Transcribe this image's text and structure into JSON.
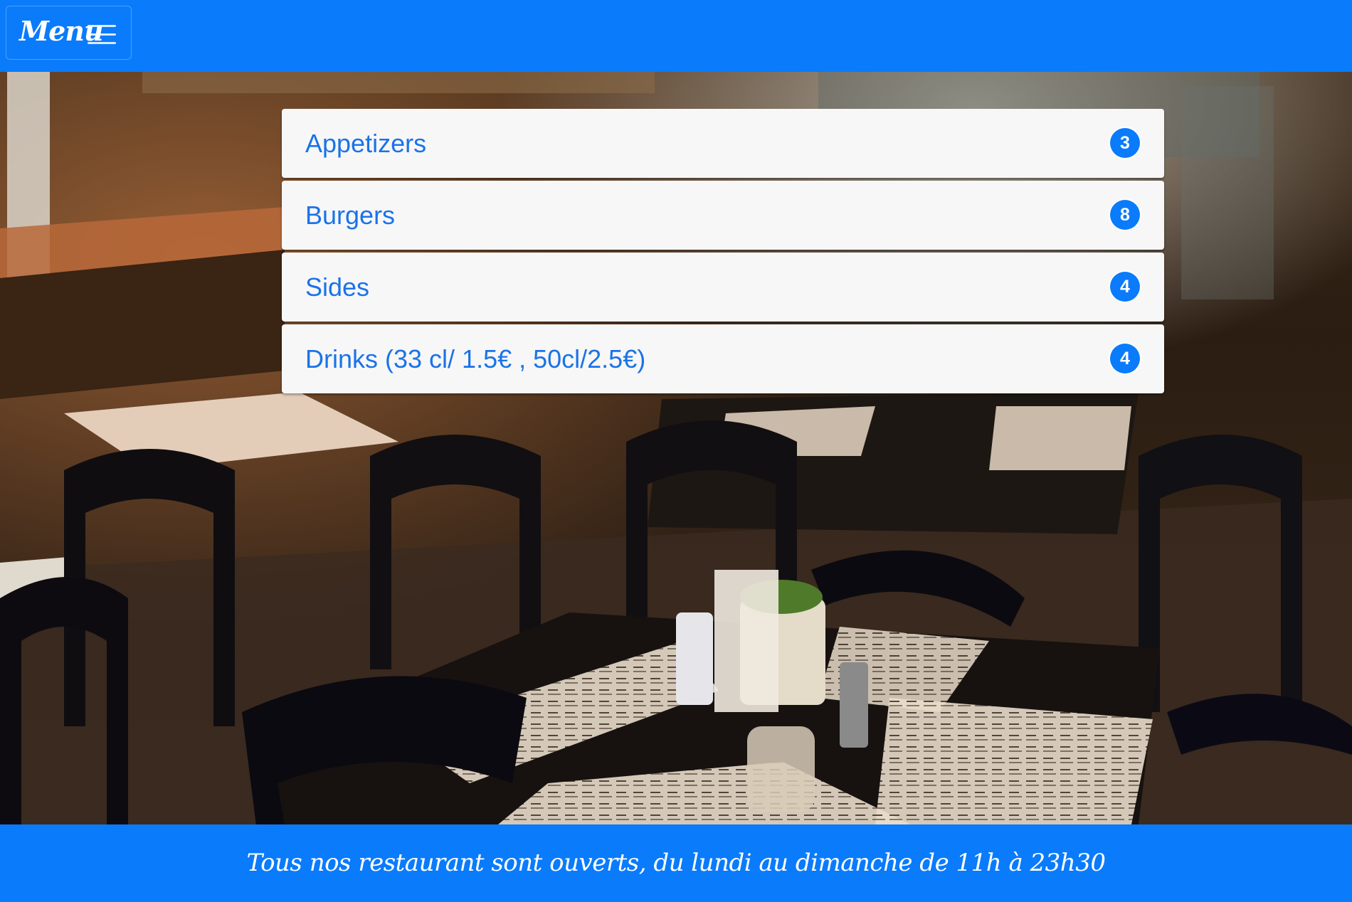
{
  "navbar": {
    "menu_label": "Menu",
    "toggle_icon": "hamburger-icon",
    "background_color": "#0a7bfb"
  },
  "categories": [
    {
      "label": "Appetizers",
      "count": "3"
    },
    {
      "label": "Burgers",
      "count": "8"
    },
    {
      "label": "Sides",
      "count": "4"
    },
    {
      "label": "Drinks (33 cl/ 1.5€ , 50cl/2.5€)",
      "count": "4"
    }
  ],
  "colors": {
    "accent": "#0a7bfb",
    "link_text": "#1a73e8",
    "list_item_bg": "#f7f7f7"
  },
  "footer": {
    "text": "Tous nos restaurant sont ouverts, du lundi au dimanche de 11h à 23h30"
  }
}
